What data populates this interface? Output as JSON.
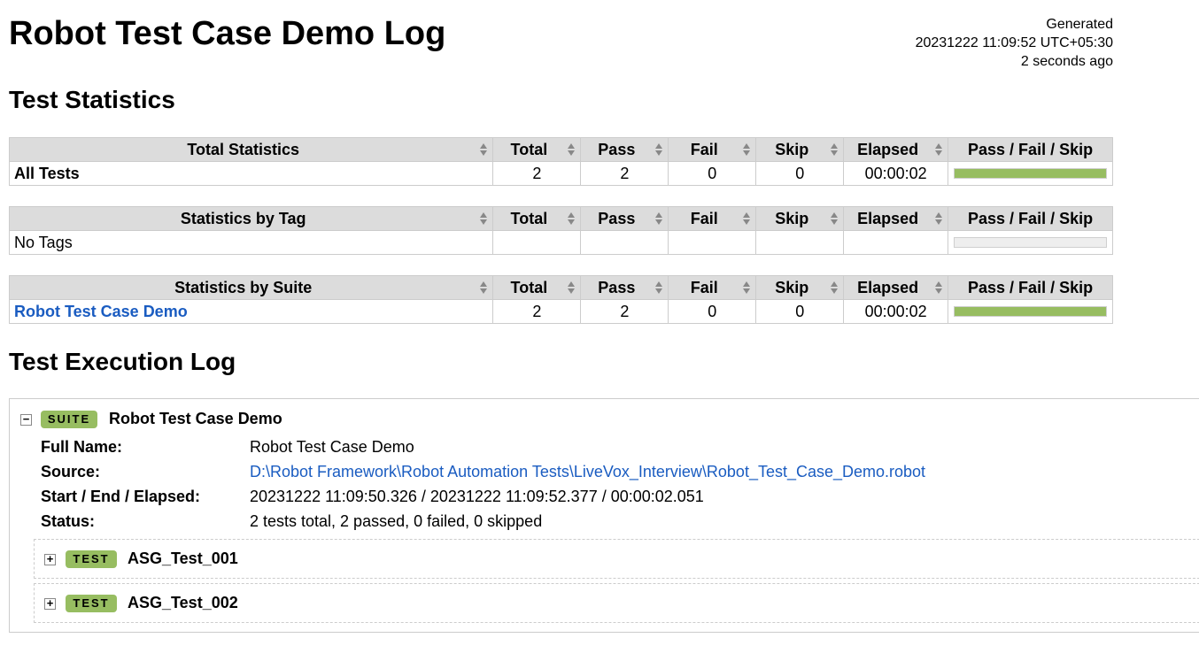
{
  "page": {
    "title": "Robot Test Case Demo Log",
    "generated_label": "Generated",
    "generated_time": "20231222 11:09:52 UTC+05:30",
    "generated_ago": "2 seconds ago"
  },
  "statistics": {
    "heading": "Test Statistics",
    "columns": [
      "Total",
      "Pass",
      "Fail",
      "Skip",
      "Elapsed",
      "Pass / Fail / Skip"
    ],
    "total": {
      "header": "Total Statistics",
      "row": {
        "name": "All Tests",
        "total": "2",
        "pass": "2",
        "fail": "0",
        "skip": "0",
        "elapsed": "00:00:02",
        "pass_ratio": 1.0
      }
    },
    "tag": {
      "header": "Statistics by Tag",
      "row": {
        "name": "No Tags",
        "total": "",
        "pass": "",
        "fail": "",
        "skip": "",
        "elapsed": "",
        "pass_ratio": 0
      }
    },
    "suite": {
      "header": "Statistics by Suite",
      "row": {
        "name": "Robot Test Case Demo",
        "total": "2",
        "pass": "2",
        "fail": "0",
        "skip": "0",
        "elapsed": "00:00:02",
        "pass_ratio": 1.0
      }
    }
  },
  "log": {
    "heading": "Test Execution Log",
    "suite": {
      "toggle": "−",
      "label": "SUITE",
      "name": "Robot Test Case Demo",
      "full_name_label": "Full Name:",
      "full_name": "Robot Test Case Demo",
      "source_label": "Source:",
      "source": "D:\\Robot Framework\\Robot Automation Tests\\LiveVox_Interview\\Robot_Test_Case_Demo.robot",
      "times_label": "Start / End / Elapsed:",
      "times": "20231222 11:09:50.326 / 20231222 11:09:52.377 / 00:00:02.051",
      "status_label": "Status:",
      "status": "2 tests total, 2 passed, 0 failed, 0 skipped"
    },
    "tests": [
      {
        "toggle": "+",
        "label": "TEST",
        "name": "ASG_Test_001"
      },
      {
        "toggle": "+",
        "label": "TEST",
        "name": "ASG_Test_002"
      }
    ]
  },
  "colors": {
    "pass": "#97bd61",
    "link": "#1a5cc1",
    "header_bg": "#dcdcdc"
  }
}
